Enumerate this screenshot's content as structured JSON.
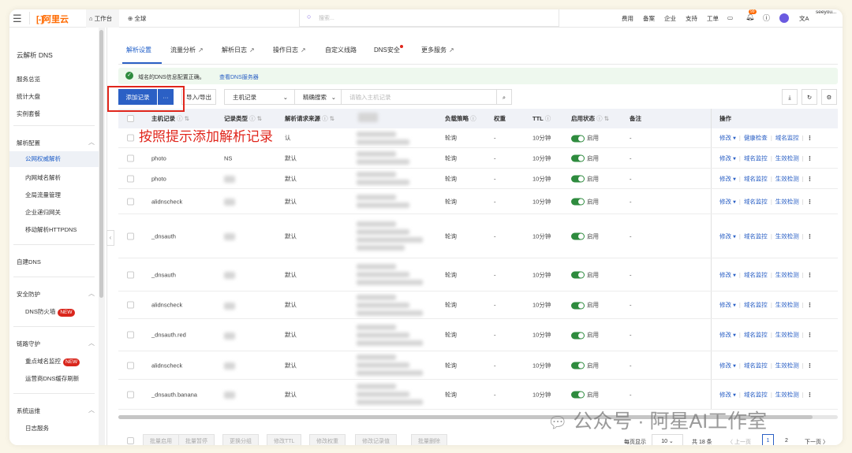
{
  "topbar": {
    "brand": "阿里云",
    "workbench": "工作台",
    "region": "全球",
    "search_placeholder": "搜索...",
    "links": [
      "费用",
      "备案",
      "企业",
      "支持",
      "工单"
    ],
    "notif_count": "99",
    "user": "seeyou..."
  },
  "sidebar": {
    "title": "云解析 DNS",
    "top_items": [
      "服务总览",
      "统计大盘",
      "实例套餐"
    ],
    "groups": [
      {
        "label": "解析配置",
        "items": [
          "公网权威解析",
          "内网域名解析",
          "全局流量管理",
          "企业递归网关",
          "移动解析HTTPDNS"
        ],
        "active": "公网权威解析"
      },
      {
        "label": "自建DNS",
        "items": []
      },
      {
        "label": "安全防护",
        "items": [
          "DNS防火墙"
        ],
        "new": [
          "DNS防火墙"
        ]
      },
      {
        "label": "链路守护",
        "items": [
          "重点域名监控",
          "运营商DNS缓存刷新"
        ],
        "new": [
          "重点域名监控"
        ]
      },
      {
        "label": "系统运维",
        "items": [
          "日志服务"
        ]
      }
    ],
    "new_badge": "NEW"
  },
  "tabs": [
    "解析设置",
    "流量分析",
    "解析日志",
    "操作日志",
    "自定义线路",
    "DNS安全",
    "更多服务"
  ],
  "notice": {
    "text": "域名的DNS信息配置正确。",
    "link": "查看DNS服务器"
  },
  "toolbar": {
    "add": "添加记录",
    "more": "···",
    "import_export": "导入/导出",
    "field_select": "主机记录",
    "match_select": "精确搜索",
    "search_placeholder": "请输入主机记录"
  },
  "annotation": "按照提示添加解析记录",
  "columns": {
    "host": "主机记录",
    "type": "记录类型",
    "source": "解析请求来源",
    "policy": "负载策略",
    "weight": "权重",
    "ttl": "TTL",
    "status": "启用状态",
    "remark": "备注",
    "ops": "操作"
  },
  "rows": [
    {
      "host": "",
      "type": "",
      "source": "认",
      "policy": "轮询",
      "weight": "-",
      "ttl": "10分钟",
      "status": "启用",
      "remark": "-",
      "ops": [
        "修改",
        "健康检查",
        "域名监控"
      ]
    },
    {
      "host": "photo",
      "type": "NS",
      "source": "默认",
      "policy": "轮询",
      "weight": "-",
      "ttl": "10分钟",
      "status": "启用",
      "remark": "-",
      "ops": [
        "修改",
        "域名监控",
        "生效检测"
      ]
    },
    {
      "host": "photo",
      "type": "",
      "source": "默认",
      "policy": "轮询",
      "weight": "-",
      "ttl": "10分钟",
      "status": "启用",
      "remark": "-",
      "ops": [
        "修改",
        "域名监控",
        "生效检测"
      ]
    },
    {
      "host": "alidnscheck",
      "type": "",
      "source": "默认",
      "policy": "轮询",
      "weight": "-",
      "ttl": "10分钟",
      "status": "启用",
      "remark": "-",
      "ops": [
        "修改",
        "域名监控",
        "生效检测"
      ]
    },
    {
      "host": "_dnsauth",
      "type": "",
      "source": "默认",
      "policy": "轮询",
      "weight": "-",
      "ttl": "10分钟",
      "status": "启用",
      "remark": "-",
      "ops": [
        "修改",
        "域名监控",
        "生效检测"
      ]
    },
    {
      "host": "_dnsauth",
      "type": "",
      "source": "默认",
      "policy": "轮询",
      "weight": "-",
      "ttl": "10分钟",
      "status": "启用",
      "remark": "-",
      "ops": [
        "修改",
        "域名监控",
        "生效检测"
      ]
    },
    {
      "host": "alidnscheck",
      "type": "",
      "source": "默认",
      "policy": "轮询",
      "weight": "-",
      "ttl": "10分钟",
      "status": "启用",
      "remark": "-",
      "ops": [
        "修改",
        "域名监控",
        "生效检测"
      ]
    },
    {
      "host": "_dnsauth.red",
      "type": "",
      "source": "默认",
      "policy": "轮询",
      "weight": "-",
      "ttl": "10分钟",
      "status": "启用",
      "remark": "-",
      "ops": [
        "修改",
        "域名监控",
        "生效检测"
      ]
    },
    {
      "host": "alidnscheck",
      "type": "",
      "source": "默认",
      "policy": "轮询",
      "weight": "-",
      "ttl": "10分钟",
      "status": "启用",
      "remark": "-",
      "ops": [
        "修改",
        "域名监控",
        "生效检测"
      ]
    },
    {
      "host": "_dnsauth.banana",
      "type": "",
      "source": "默认",
      "policy": "轮询",
      "weight": "-",
      "ttl": "10分钟",
      "status": "启用",
      "remark": "-",
      "ops": [
        "修改",
        "域名监控",
        "生效检测"
      ]
    }
  ],
  "bulk": [
    "批量启用",
    "批量暂停",
    "更换分组",
    "修改TTL",
    "修改权重",
    "修改记录值",
    "批量删除"
  ],
  "pager": {
    "page_size_label": "每页显示",
    "page_size": "10",
    "total": "共 18 条",
    "prev": "上一页",
    "pages": [
      "1",
      "2"
    ],
    "current": "1",
    "next": "下一页"
  },
  "watermark": "公众号 · 阿星AI工作室",
  "colors": {
    "accent": "#2b60c5",
    "annotation": "#e0261c",
    "toggle": "#2e8b3e"
  }
}
